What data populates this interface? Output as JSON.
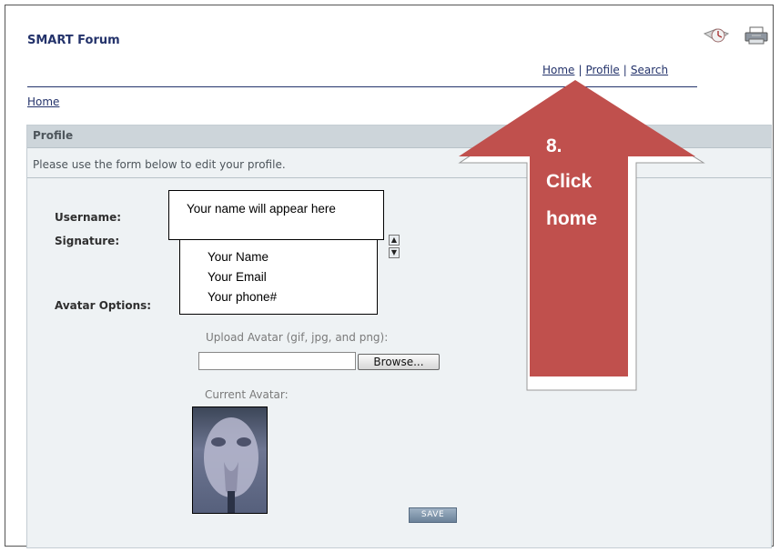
{
  "header": {
    "site_title": "SMART Forum",
    "icons": [
      "clock-email-icon",
      "printer-icon"
    ],
    "nav": {
      "home": "Home",
      "separator": "|",
      "profile": "Profile",
      "search": "Search"
    }
  },
  "breadcrumb": {
    "home": "Home"
  },
  "panel": {
    "title": "Profile",
    "description": "Please use the form below to edit your profile."
  },
  "form": {
    "username_label": "Username:",
    "signature_label": "Signature:",
    "avatar_options_label": "Avatar Options:",
    "username_callout": "Your name will appear here",
    "signature_lines": [
      "Your Name",
      "Your Email",
      "Your phone#"
    ],
    "upload_label": "Upload Avatar (gif, jpg, and png):",
    "file_input_value": "",
    "browse_label": "Browse...",
    "current_avatar_label": "Current Avatar:",
    "save_label": "SAVE"
  },
  "annotation": {
    "step": "8.",
    "line1": "Click",
    "line2": "home",
    "color": "#c0504d"
  }
}
